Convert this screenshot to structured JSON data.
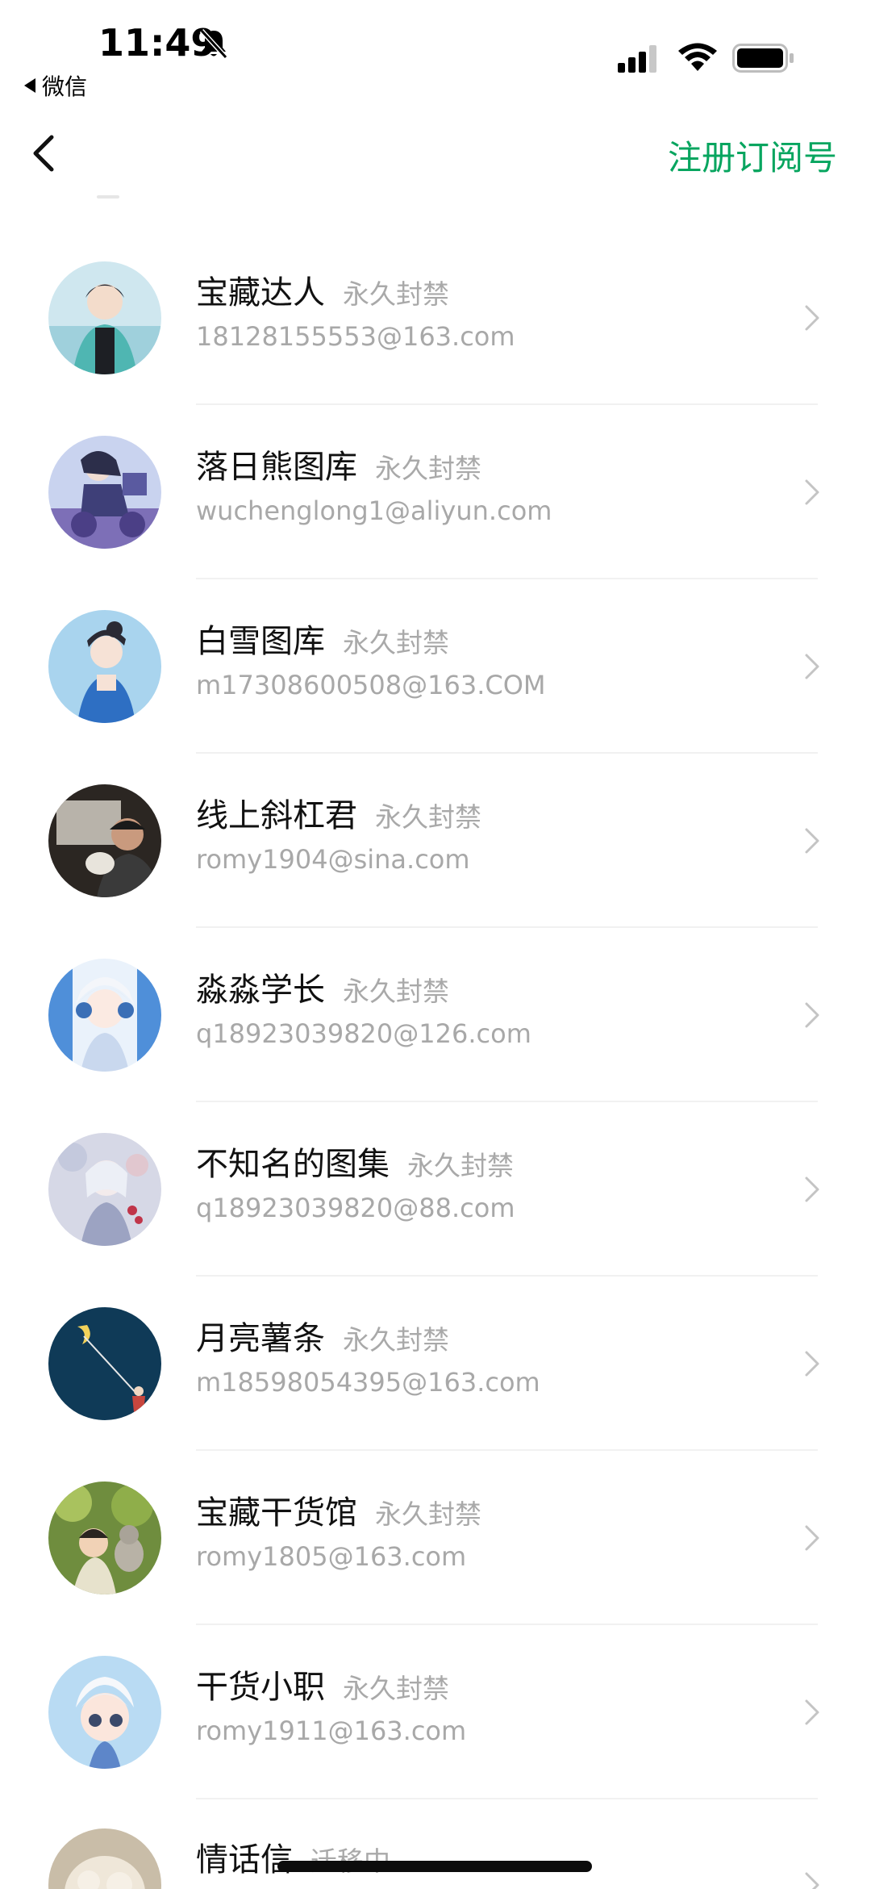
{
  "status_bar": {
    "time": "11:49",
    "back_app_label": "微信"
  },
  "nav": {
    "action_label": "注册订阅号"
  },
  "accounts": [
    {
      "name": "宝藏达人",
      "tag": "永久封禁",
      "email": "18128155553@163.com",
      "avatar": "anime boy in teal jacket by the sea"
    },
    {
      "name": "落日熊图库",
      "tag": "永久封禁",
      "email": "wuchenglong1@aliyun.com",
      "avatar": "anime figure on purple scooter"
    },
    {
      "name": "白雪图库",
      "tag": "永久封禁",
      "email": "m17308600508@163.COM",
      "avatar": "anime girl in blue top"
    },
    {
      "name": "线上斜杠君",
      "tag": "永久封禁",
      "email": "romy1904@sina.com",
      "avatar": "man with dog in car"
    },
    {
      "name": "淼淼学长",
      "tag": "永久封禁",
      "email": "q18923039820@126.com",
      "avatar": "white-haired anime boy with headphones"
    },
    {
      "name": "不知名的图集",
      "tag": "永久封禁",
      "email": "q18923039820@88.com",
      "avatar": "pale anime girl with flowers"
    },
    {
      "name": "月亮薯条",
      "tag": "永久封禁",
      "email": "m18598054395@163.com",
      "avatar": "figure fishing the moon at night"
    },
    {
      "name": "宝藏干货馆",
      "tag": "永久封禁",
      "email": "romy1805@163.com",
      "avatar": "boy with cat under green leaves"
    },
    {
      "name": "干货小职",
      "tag": "永久封禁",
      "email": "romy1911@163.com",
      "avatar": "chibi anime boy with white hair"
    },
    {
      "name": "情话信",
      "tag": "迁移中",
      "email": "",
      "avatar": "fluffy beige animal"
    }
  ]
}
